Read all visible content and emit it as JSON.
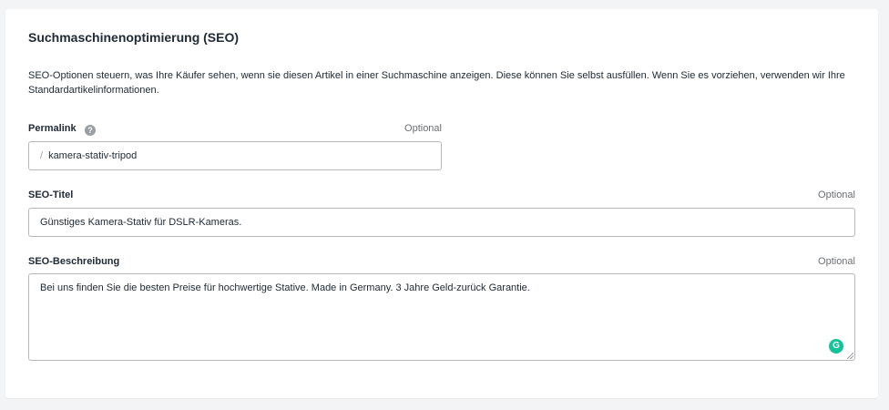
{
  "section": {
    "title": "Suchmaschinenoptimierung (SEO)",
    "description": "SEO-Optionen steuern, was Ihre Käufer sehen, wenn sie diesen Artikel in einer Suchmaschine anzeigen. Diese können Sie selbst ausfüllen. Wenn Sie es vorziehen, verwenden wir Ihre Standardartikelinformationen."
  },
  "permalink": {
    "label": "Permalink",
    "help": "?",
    "optional": "Optional",
    "prefix": "/",
    "value": "kamera-stativ-tripod"
  },
  "seo_title": {
    "label": "SEO-Titel",
    "optional": "Optional",
    "value": "Günstiges Kamera-Stativ für DSLR-Kameras."
  },
  "seo_description": {
    "label": "SEO-Beschreibung",
    "optional": "Optional",
    "value": "Bei uns finden Sie die besten Preise für hochwertige Stative. Made in Germany. 3 Jahre Geld-zurück Garantie.",
    "grammarly_badge": "G"
  },
  "icons": {
    "help": "question-circle-icon",
    "grammarly": "grammarly-icon"
  },
  "colors": {
    "grammarly": "#15c39a",
    "border": "#b5b9bd"
  }
}
